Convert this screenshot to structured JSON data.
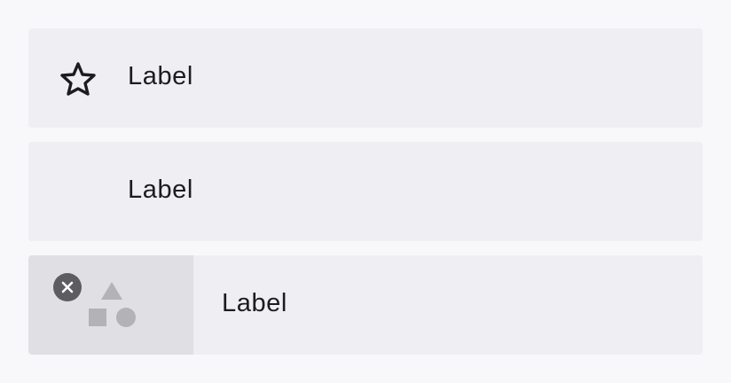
{
  "list": {
    "items": [
      {
        "label": "Label",
        "leading": "star-icon"
      },
      {
        "label": "Label",
        "leading": "none"
      },
      {
        "label": "Label",
        "leading": "shapes-icon",
        "badge": "close-icon"
      }
    ]
  },
  "colors": {
    "page_background": "#f8f8fa",
    "item_background": "#efeef3",
    "media_background": "#e0dfe4",
    "text": "#1d1b20",
    "icon_muted": "#b3b2b8",
    "badge": "#5d5c63"
  }
}
